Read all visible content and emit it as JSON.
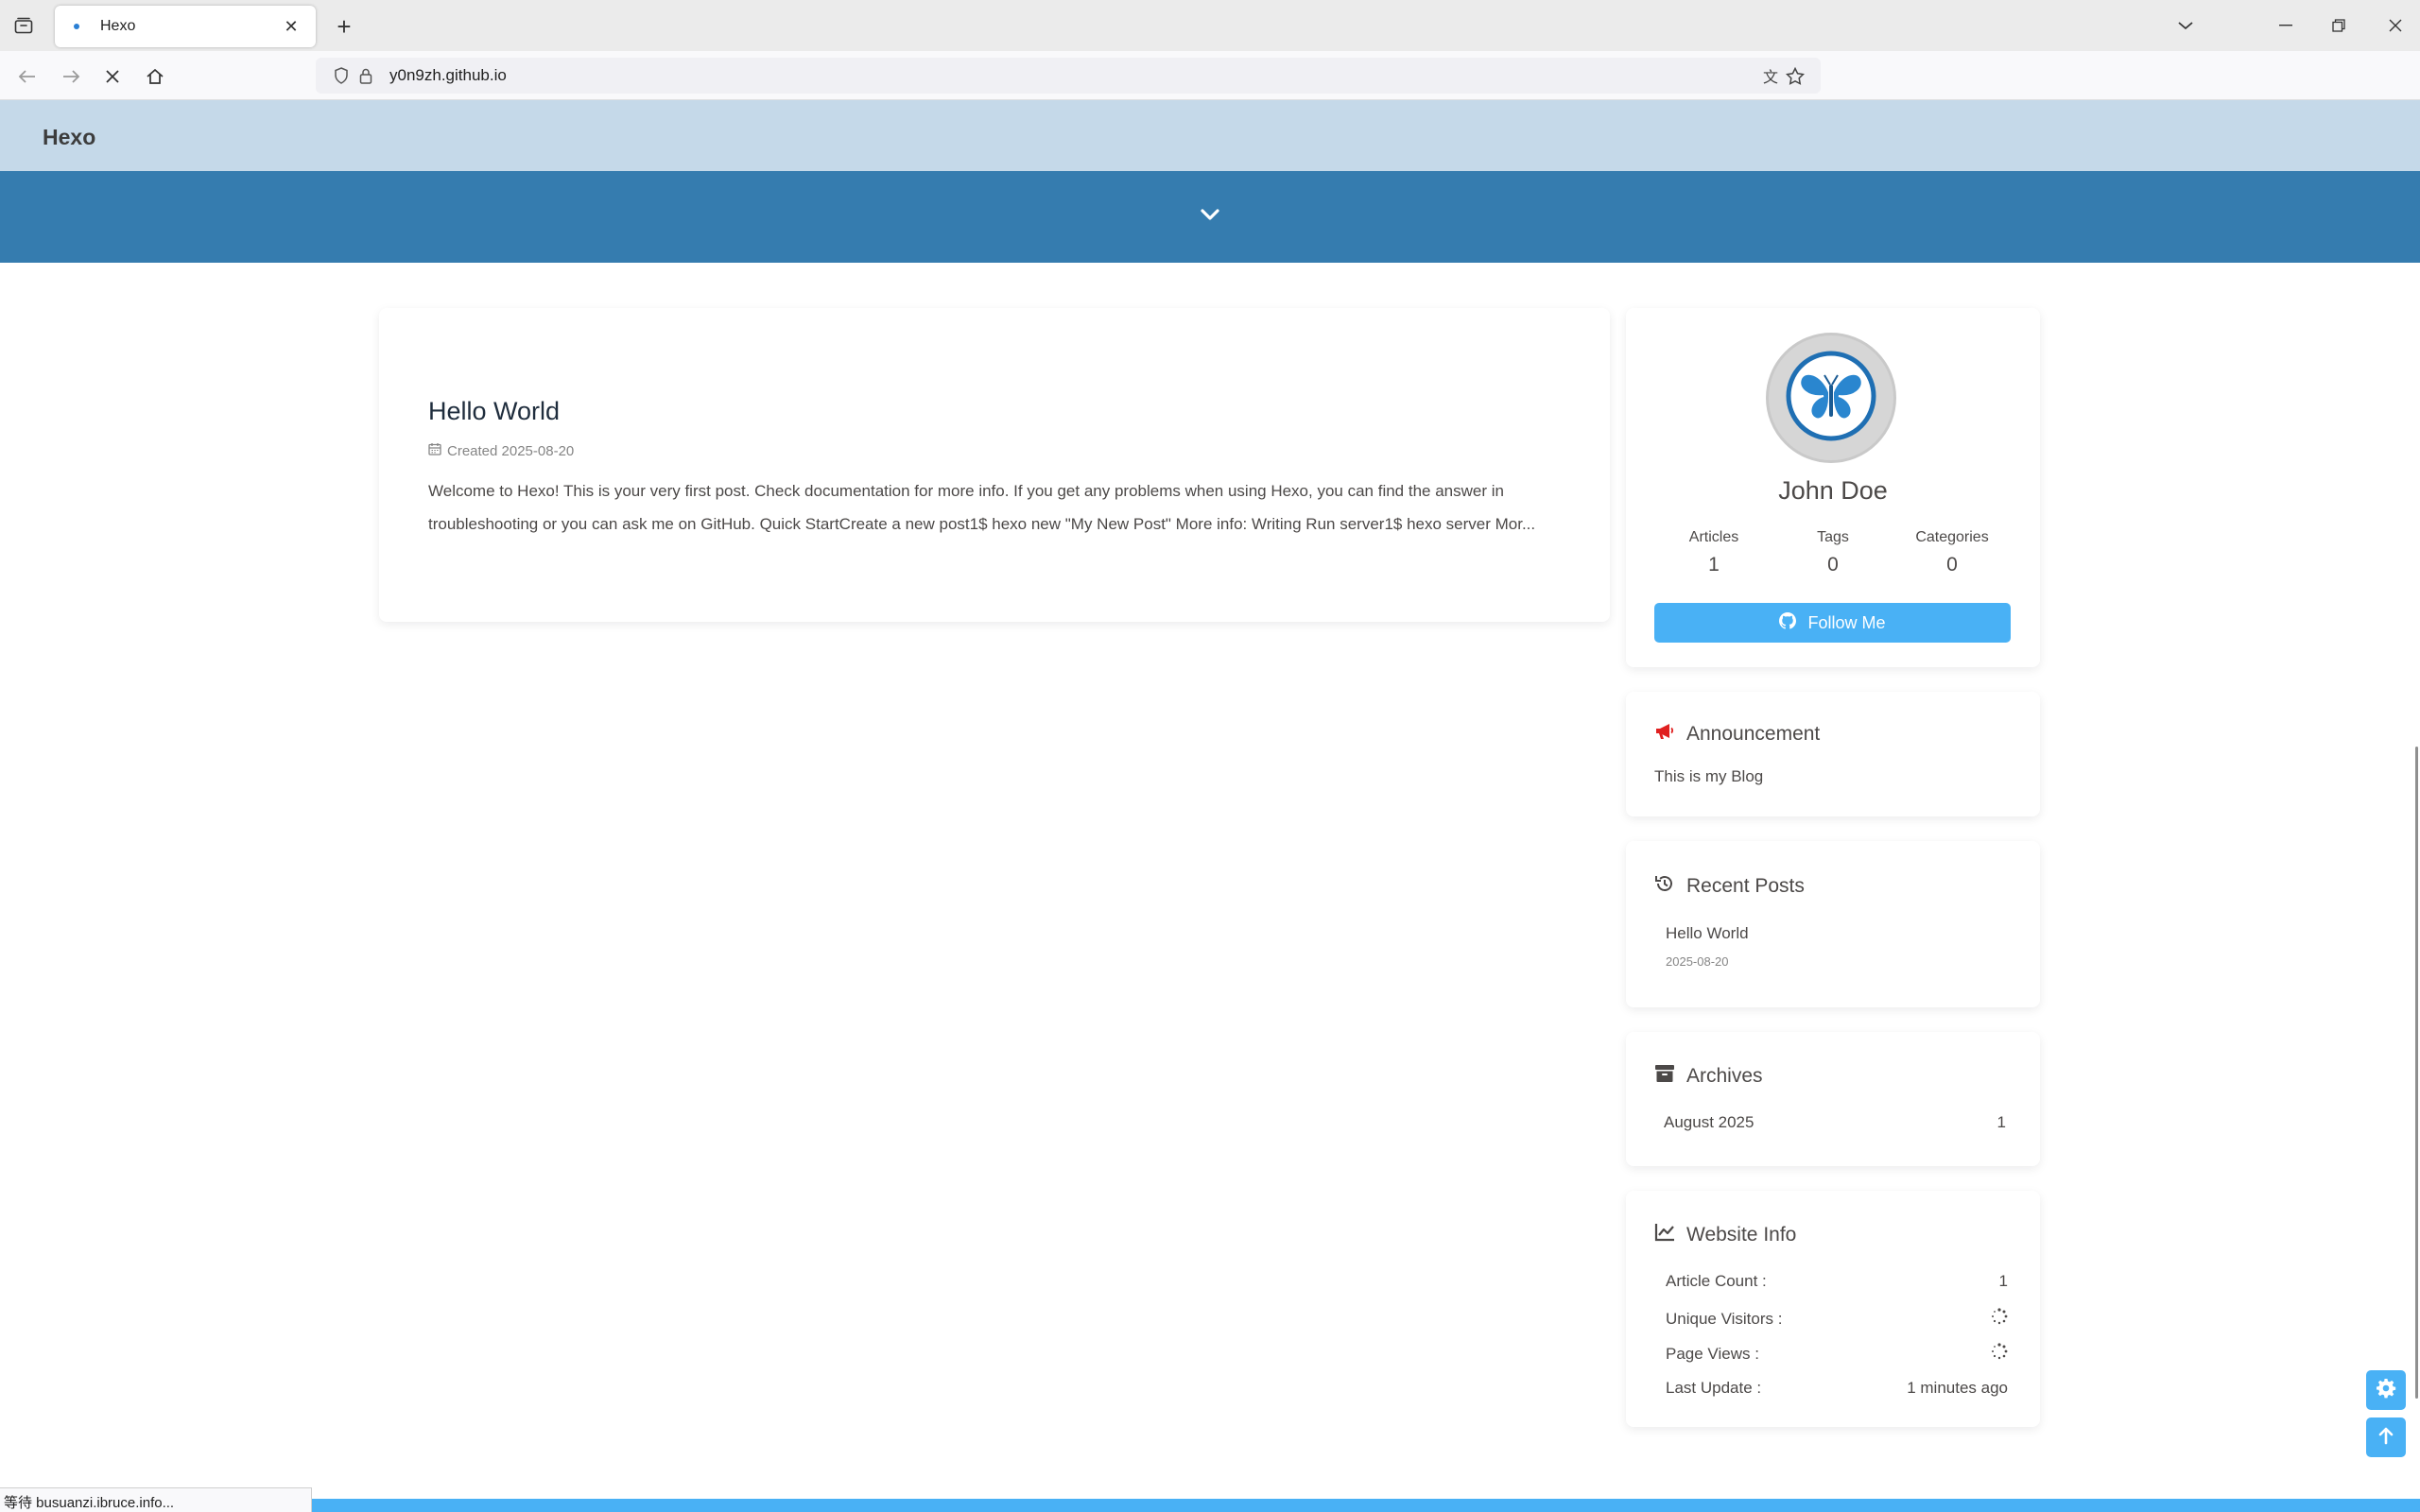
{
  "browser": {
    "tab_title": "Hexo",
    "url": "y0n9zh.github.io",
    "status_text": "等待 busuanzi.ibruce.info..."
  },
  "site": {
    "brand": "Hexo"
  },
  "post": {
    "title": "Hello World",
    "meta": "Created 2025-08-20",
    "excerpt": "Welcome to Hexo! This is your very first post. Check documentation for more info. If you get any problems when using Hexo, you can find the answer in troubleshooting or you can ask me on GitHub. Quick StartCreate a new post1$ hexo new \"My New Post\" More info: Writing Run server1$ hexo server Mor..."
  },
  "author": {
    "name": "John Doe",
    "stats": [
      {
        "label": "Articles",
        "value": "1"
      },
      {
        "label": "Tags",
        "value": "0"
      },
      {
        "label": "Categories",
        "value": "0"
      }
    ],
    "follow_label": "Follow Me"
  },
  "announcement": {
    "heading": "Announcement",
    "text": "This is my Blog"
  },
  "recent": {
    "heading": "Recent Posts",
    "items": [
      {
        "title": "Hello World",
        "date": "2025-08-20"
      }
    ]
  },
  "archives": {
    "heading": "Archives",
    "items": [
      {
        "label": "August 2025",
        "count": "1"
      }
    ]
  },
  "website_info": {
    "heading": "Website Info",
    "rows": [
      {
        "label": "Article Count :",
        "value": "1"
      },
      {
        "label": "Unique Visitors :",
        "value": ""
      },
      {
        "label": "Page Views :",
        "value": ""
      },
      {
        "label": "Last Update :",
        "value": "1 minutes ago"
      }
    ]
  },
  "colors": {
    "header_bg": "#c5d9e9",
    "banner_bg": "#357caf",
    "accent": "#49b1f5",
    "announcement_icon": "#e02020"
  },
  "icons": {
    "tab_list": "tab-list-icon",
    "back": "back-arrow-icon",
    "forward": "forward-arrow-icon",
    "stop": "stop-loading-icon",
    "home": "home-icon",
    "shield": "tracking-shield-icon",
    "lock": "lock-icon",
    "translate": "translate-icon",
    "bookmark": "bookmark-star-icon",
    "banner_scroll": "chevron-down-icon",
    "calendar": "calendar-icon",
    "github": "github-icon",
    "announcement": "bullhorn-icon",
    "recent": "history-icon",
    "archive": "archive-box-icon",
    "website_info": "line-chart-icon",
    "settings": "gear-icon",
    "back_to_top": "arrow-up-icon"
  }
}
